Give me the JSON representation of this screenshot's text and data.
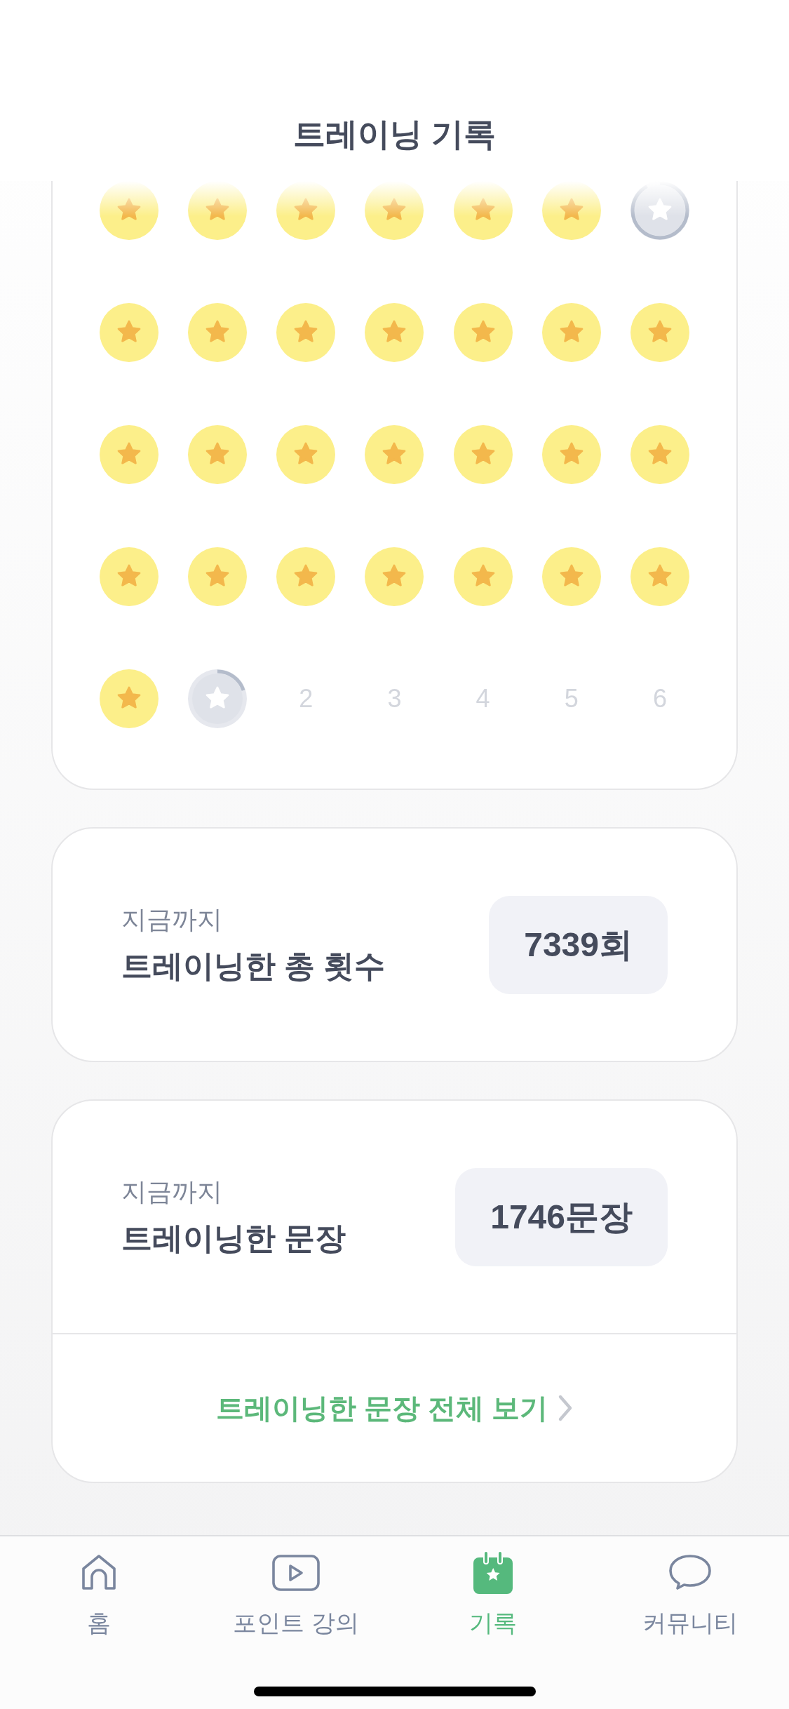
{
  "header": {
    "title": "트레이닝 기록"
  },
  "calendar": {
    "cells": [
      {
        "kind": "done"
      },
      {
        "kind": "done"
      },
      {
        "kind": "done"
      },
      {
        "kind": "done"
      },
      {
        "kind": "done"
      },
      {
        "kind": "done"
      },
      {
        "kind": "progress",
        "level": 0.92
      },
      {
        "kind": "done"
      },
      {
        "kind": "done"
      },
      {
        "kind": "done"
      },
      {
        "kind": "done"
      },
      {
        "kind": "done"
      },
      {
        "kind": "done"
      },
      {
        "kind": "done"
      },
      {
        "kind": "done"
      },
      {
        "kind": "done"
      },
      {
        "kind": "done"
      },
      {
        "kind": "done"
      },
      {
        "kind": "done"
      },
      {
        "kind": "done"
      },
      {
        "kind": "done"
      },
      {
        "kind": "done"
      },
      {
        "kind": "done"
      },
      {
        "kind": "done"
      },
      {
        "kind": "done"
      },
      {
        "kind": "done"
      },
      {
        "kind": "done"
      },
      {
        "kind": "done"
      },
      {
        "kind": "done"
      },
      {
        "kind": "progress",
        "level": 0.2
      },
      {
        "kind": "day",
        "label": "2"
      },
      {
        "kind": "day",
        "label": "3"
      },
      {
        "kind": "day",
        "label": "4"
      },
      {
        "kind": "day",
        "label": "5"
      },
      {
        "kind": "day",
        "label": "6"
      }
    ]
  },
  "stats": [
    {
      "caption": "지금까지",
      "title": "트레이닝한 총 횟수",
      "value": "7339회"
    },
    {
      "caption": "지금까지",
      "title": "트레이닝한 문장",
      "value": "1746문장",
      "link": "트레이닝한 문장 전체 보기"
    }
  ],
  "nav": {
    "items": [
      {
        "kind": "home",
        "label": "홈",
        "selected": false
      },
      {
        "kind": "video",
        "label": "포인트 강의",
        "selected": false
      },
      {
        "kind": "record",
        "label": "기록",
        "selected": true
      },
      {
        "kind": "chat",
        "label": "커뮤니티",
        "selected": false
      }
    ]
  }
}
